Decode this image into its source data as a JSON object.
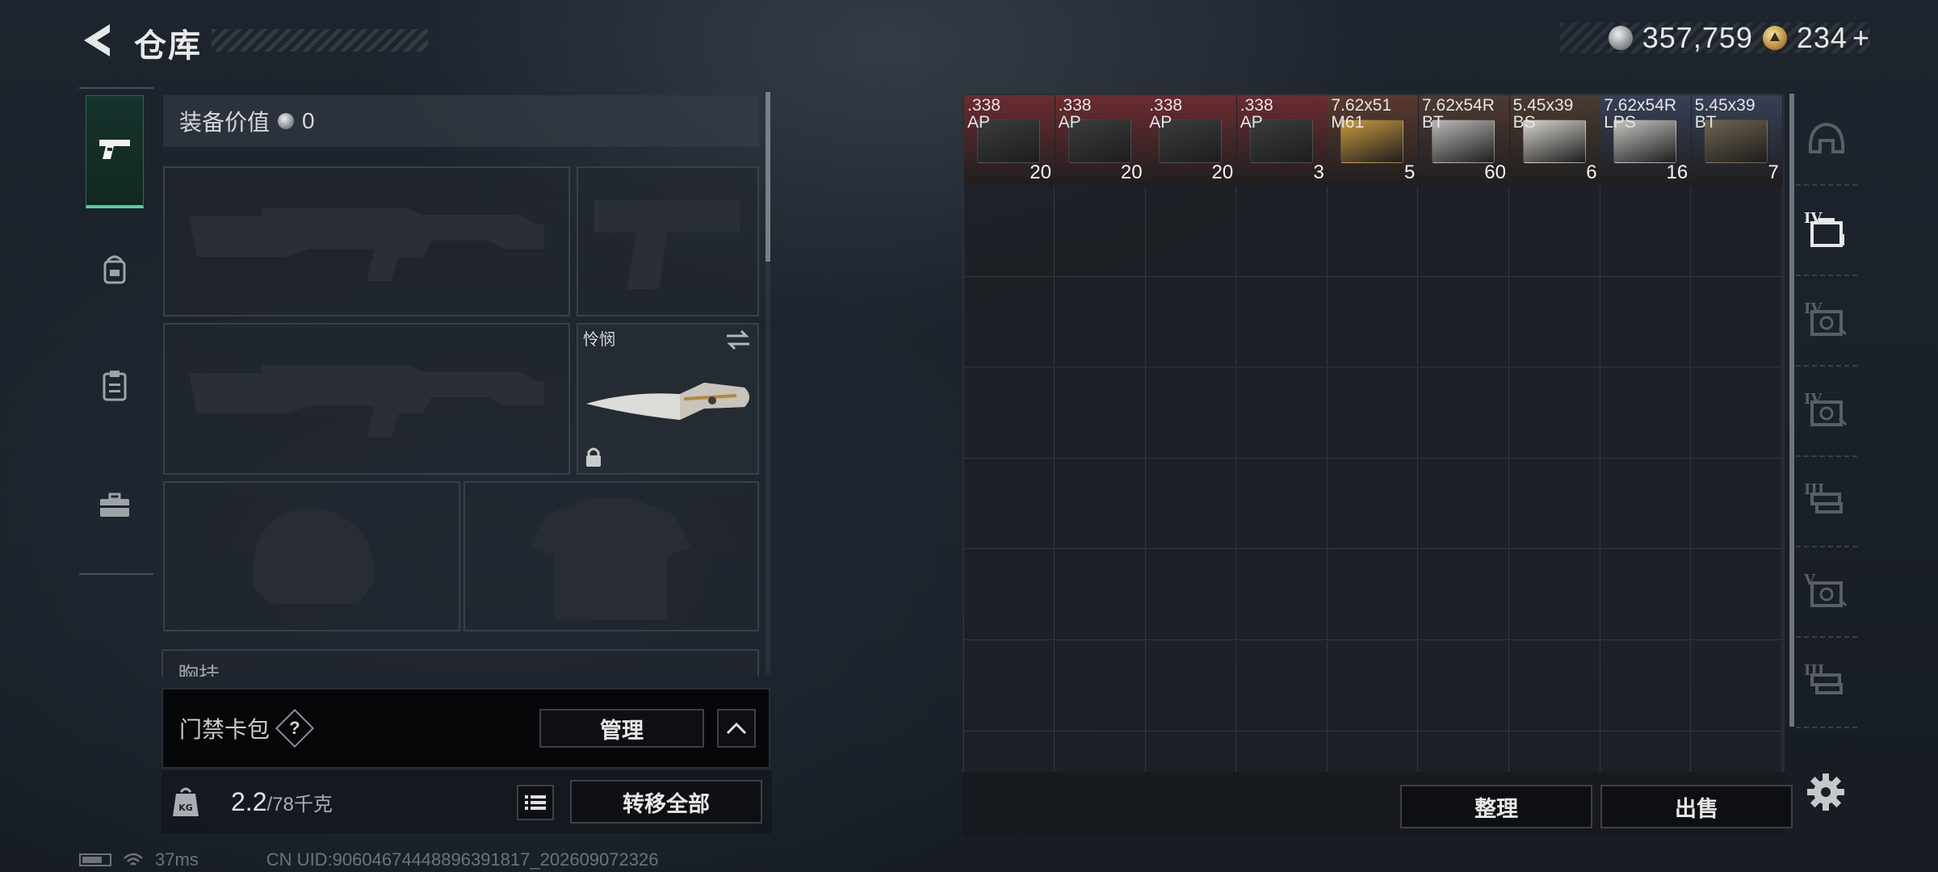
{
  "header": {
    "title": "仓库",
    "currencies": [
      {
        "icon": "silver-coin-icon",
        "value": "357,759"
      },
      {
        "icon": "gold-coin-icon",
        "value": "234",
        "suffix": "+"
      }
    ]
  },
  "rail": {
    "items": [
      {
        "icon": "pistol-icon",
        "active": true
      },
      {
        "icon": "backpack-icon",
        "active": false
      },
      {
        "icon": "clipboard-icon",
        "active": false
      },
      {
        "icon": "toolbox-icon",
        "active": false
      }
    ]
  },
  "equipment": {
    "value_label": "装备价值",
    "value": "0",
    "melee_name": "怜悯",
    "chest_label": "胸挂"
  },
  "keycard": {
    "label": "门禁卡包",
    "help": "?",
    "manage_label": "管理"
  },
  "weight": {
    "current": "2.2",
    "capacity": "/78千克",
    "transfer_all_label": "转移全部"
  },
  "status": {
    "ping": "37ms",
    "uid": "CN UID:9060467444889639181​7_202609072326"
  },
  "storage": {
    "items": [
      {
        "name": ".338\nAP",
        "qty": "20",
        "tint": "#6b2c31",
        "box": "#3a3c3c"
      },
      {
        "name": ".338\nAP",
        "qty": "20",
        "tint": "#6b2c31",
        "box": "#3a3c3c"
      },
      {
        "name": ".338\nAP",
        "qty": "20",
        "tint": "#6b2c31",
        "box": "#3a3c3c"
      },
      {
        "name": ".338\nAP",
        "qty": "3",
        "tint": "#6b2c31",
        "box": "#3a3c3c"
      },
      {
        "name": "7.62x51\nM61",
        "qty": "5",
        "tint": "#5a3a2e",
        "box": "#c89a3c"
      },
      {
        "name": "7.62x54R\nBT",
        "qty": "60",
        "tint": "#4d3a33",
        "box": "#b9b9b5"
      },
      {
        "name": "5.45x39\nBS",
        "qty": "6",
        "tint": "#4a3a31",
        "box": "#d6d4cc"
      },
      {
        "name": "7.62x54R\nLPS",
        "qty": "16",
        "tint": "#394056",
        "box": "#c6c5c0"
      },
      {
        "name": "5.45x39\nBT",
        "qty": "7",
        "tint": "#394056",
        "box": "#6f6450"
      }
    ],
    "sort_label": "整理",
    "sell_label": "出售"
  },
  "container_tabs": [
    {
      "tier": "",
      "icon": "helmet-container-icon",
      "active": false
    },
    {
      "tier": "IV",
      "icon": "case-container-icon",
      "active": true
    },
    {
      "tier": "IV",
      "icon": "safe-container-icon",
      "active": false
    },
    {
      "tier": "IV",
      "icon": "safe-container-icon",
      "active": false
    },
    {
      "tier": "III",
      "icon": "rig-container-icon",
      "active": false
    },
    {
      "tier": "V",
      "icon": "safe-container-icon",
      "active": false
    },
    {
      "tier": "III",
      "icon": "rig-container-icon",
      "active": false
    }
  ]
}
